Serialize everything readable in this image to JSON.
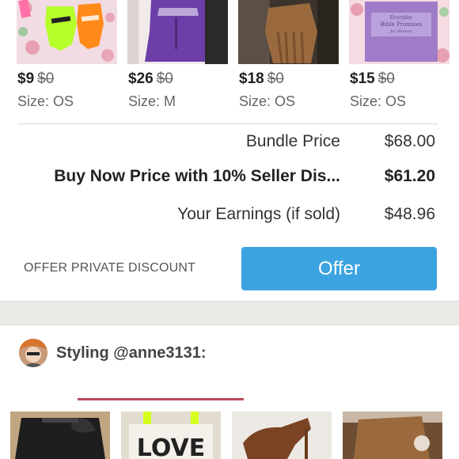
{
  "bundle_items": [
    {
      "price": "$9",
      "original_price": "$0",
      "size": "Size: OS"
    },
    {
      "price": "$26",
      "original_price": "$0",
      "size": "Size: M"
    },
    {
      "price": "$18",
      "original_price": "$0",
      "size": "Size: OS"
    },
    {
      "price": "$15",
      "original_price": "$0",
      "size": "Size: OS"
    }
  ],
  "thumb_texts": {
    "book_line1": "Everyday",
    "book_line2": "Bible Promises",
    "book_line3": "for Women",
    "tote_text": "LOVE"
  },
  "summary": {
    "bundle_price_label": "Bundle Price",
    "bundle_price_value": "$68.00",
    "buy_now_label": "Buy Now Price with 10% Seller Dis...",
    "buy_now_value": "$61.20",
    "earnings_label": "Your Earnings (if sold)",
    "earnings_value": "$48.96"
  },
  "actions": {
    "private_discount_label": "OFFER PRIVATE DISCOUNT",
    "offer_label": "Offer"
  },
  "styling": {
    "label": "Styling @anne3131:"
  },
  "colors": {
    "offer_button": "#3ba3e0",
    "tab_underline": "#b84a5a",
    "section_band": "#ebe9e6"
  }
}
